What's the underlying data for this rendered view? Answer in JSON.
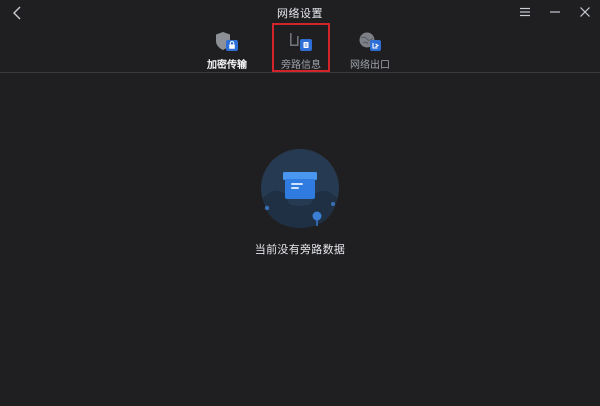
{
  "window": {
    "title": "网络设置",
    "accent": "#2d6fd6",
    "highlight_border": "#d4242b"
  },
  "titlebar": {
    "back_icon": "chevron-left-icon",
    "menu_icon": "hamburger-menu-icon",
    "minimize_icon": "minimize-icon",
    "close_icon": "close-icon"
  },
  "tabs": [
    {
      "label": "加密传输",
      "icon": "shield-lock-icon",
      "active": true
    },
    {
      "label": "旁路信息",
      "icon": "bypass-info-icon",
      "active": false
    },
    {
      "label": "网络出口",
      "icon": "globe-exit-icon",
      "active": false
    }
  ],
  "empty_state": {
    "illustration": "empty-box-icon",
    "message": "当前没有旁路数据"
  }
}
